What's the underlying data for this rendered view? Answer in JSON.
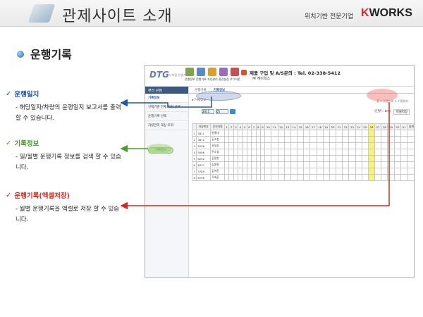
{
  "header": {
    "title": "관제사이트 소개",
    "company_tag": "위치기반 전문기업",
    "brand_k": "K",
    "brand_rest": "WORKS"
  },
  "section": {
    "title": "운행기록"
  },
  "callouts": [
    {
      "check": "✓",
      "head": "운행일지",
      "desc": "- 해당일자/차량의 운행일지 보고서를 출력할 수 있습니다.",
      "color": "#1e56b3"
    },
    {
      "check": "✓",
      "head": "기록정보",
      "desc": "- 일/월별 운행기록 정보를 검색 할 수 있습니다.",
      "color": "#4d9b2e"
    },
    {
      "check": "✓",
      "head": "운행기록(엑셀저장)",
      "desc": "- 월별 운행기록을 엑셀로 저장 할 수 있습니다.",
      "color": "#d42a1e"
    }
  ],
  "app": {
    "logo": "DTG",
    "subtitle": "디지털 운행기록계",
    "toolbar": [
      "운행정보",
      "운행기록",
      "차량관리",
      "환경설정",
      "로그아웃"
    ],
    "info": "제품 구입 및 A/S문의 : Tel. 02-338-5412",
    "info2": "㈜ 케이웍스",
    "left_head": "편리 관점",
    "left_tabs": [
      "기록정보",
      "선택기준 전체 차량 선택",
      "운행기록 선택",
      "차량관리 대상 조회"
    ],
    "green_pill": "기록정보",
    "main_tabs": [
      "운행기록",
      "기록정보"
    ],
    "crumb": "▸ 기록정보",
    "crumb_right": "홈 > 운행기록 > 기록정보",
    "select1": "2011",
    "select2": "05",
    "excel_label": "(단위 : km)",
    "excel_btn": "엑셀저장",
    "columns": [
      "차량번호",
      "운전자명",
      "1",
      "2",
      "3",
      "4",
      "5",
      "6",
      "7",
      "8",
      "9",
      "10",
      "11",
      "12",
      "13",
      "14",
      "15",
      "16",
      "17",
      "18",
      "19",
      "20",
      "21",
      "22",
      "23",
      "24",
      "25",
      "26",
      "27",
      "28",
      "29",
      "30",
      "31",
      "합계"
    ],
    "rows": [
      [
        "3811",
        "한종대"
      ],
      [
        "3872",
        "김소현"
      ],
      [
        "5536",
        "유일상"
      ],
      [
        "5096",
        "주소정"
      ],
      [
        "6202",
        "김정찬"
      ],
      [
        "6037",
        "김동현"
      ],
      [
        "5789",
        "김여운"
      ],
      [
        "6798",
        "주희준"
      ]
    ]
  }
}
